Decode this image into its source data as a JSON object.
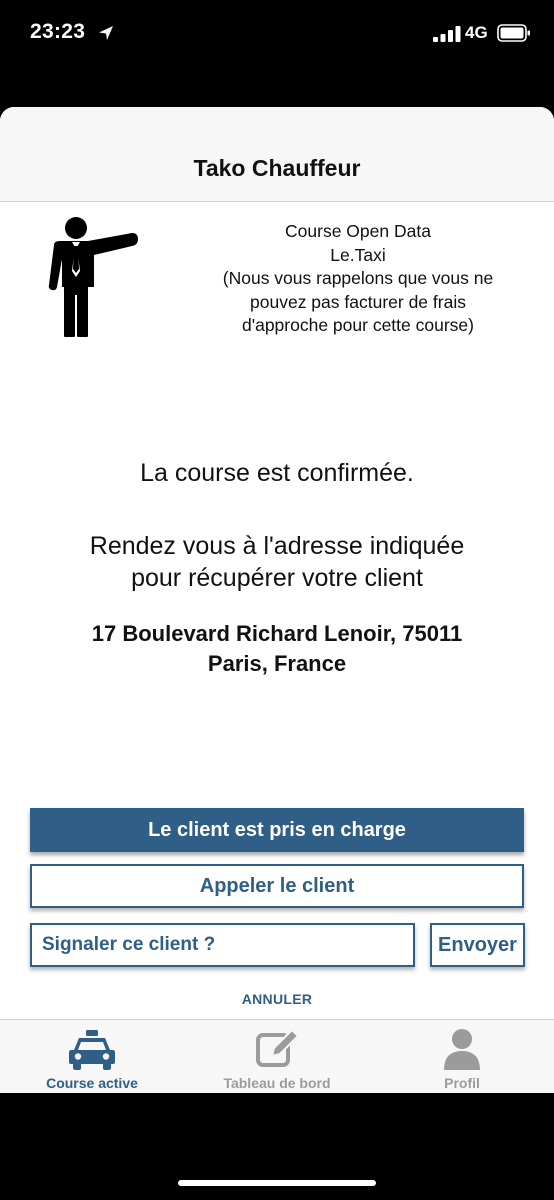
{
  "status_bar": {
    "time": "23:23",
    "network": "4G"
  },
  "header": {
    "title": "Tako Chauffeur"
  },
  "course_info": {
    "lines": [
      "Course Open Data",
      "Le.Taxi",
      "(Nous vous rappelons que vous ne",
      "pouvez pas facturer de frais",
      "d'approche pour cette course)"
    ]
  },
  "main": {
    "confirmation": "La course est confirmée.",
    "instruction_line1": "Rendez vous à l'adresse indiquée",
    "instruction_line2": "pour récupérer votre client",
    "address_line1": "17 Boulevard Richard Lenoir, 75011",
    "address_line2": "Paris, France"
  },
  "actions": {
    "pickup_label": "Le client est pris en charge",
    "call_label": "Appeler le client",
    "report_placeholder": "Signaler ce client ?",
    "send_label": "Envoyer",
    "cancel_label": "ANNULER"
  },
  "tabbar": {
    "tabs": [
      {
        "label": "Course active",
        "icon": "taxi-icon",
        "active": true
      },
      {
        "label": "Tableau de bord",
        "icon": "edit-icon",
        "active": false
      },
      {
        "label": "Profil",
        "icon": "user-icon",
        "active": false
      }
    ]
  },
  "colors": {
    "accent": "#2f5f86",
    "inactive": "#9b9b9b"
  }
}
